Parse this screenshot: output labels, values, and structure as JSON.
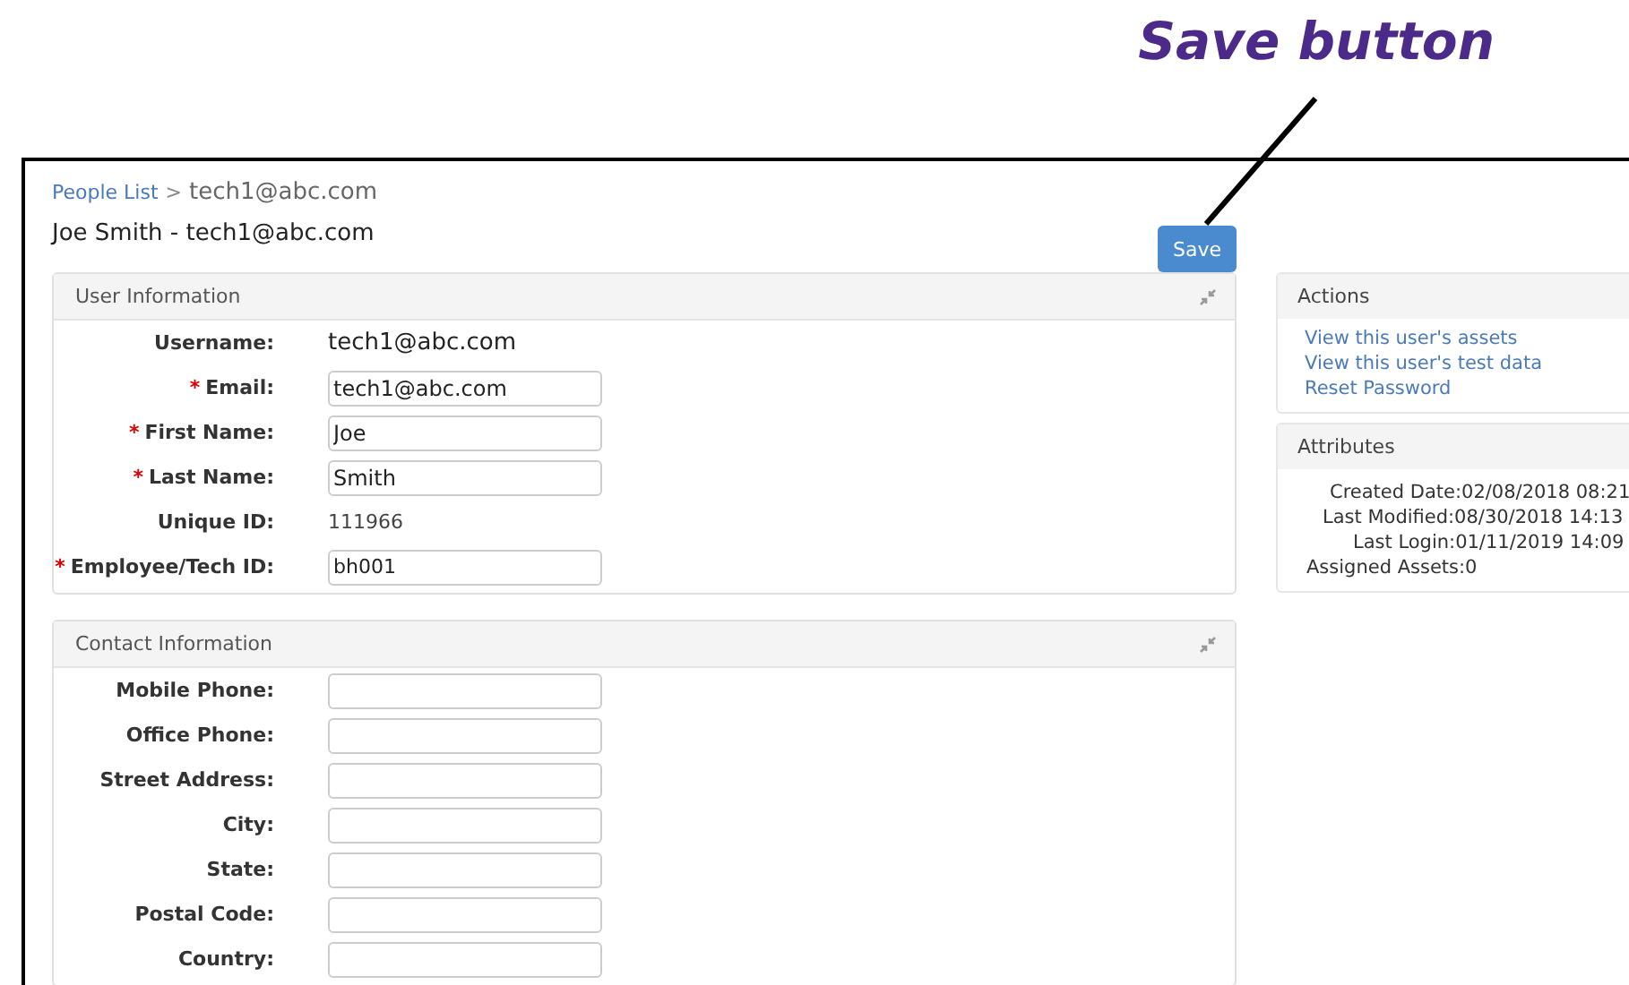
{
  "annotation": {
    "label": "Save button"
  },
  "breadcrumb": {
    "link": "People List",
    "separator": ">",
    "current": "tech1@abc.com"
  },
  "page_title": "Joe Smith - tech1@abc.com",
  "save_button": "Save",
  "user_information": {
    "title": "User Information",
    "fields": [
      {
        "label": "Username:",
        "kind": "text",
        "value": "tech1@abc.com"
      },
      {
        "required_mark": "*",
        "label": "Email:",
        "kind": "input",
        "value": "tech1@abc.com"
      },
      {
        "required_mark": "*",
        "label": "First Name:",
        "kind": "input",
        "value": "Joe"
      },
      {
        "required_mark": "*",
        "label": "Last Name:",
        "kind": "input",
        "value": "Smith"
      },
      {
        "label": "Unique ID:",
        "kind": "small-text",
        "value": "111966"
      },
      {
        "required_mark": "*",
        "label": "Employee/Tech ID:",
        "kind": "small-input",
        "value": "bh001"
      }
    ]
  },
  "contact_information": {
    "title": "Contact Information",
    "fields": [
      {
        "label": "Mobile Phone:",
        "kind": "input"
      },
      {
        "label": "Office Phone:",
        "kind": "input"
      },
      {
        "label": "Street Address:",
        "kind": "input"
      },
      {
        "label": "City:",
        "kind": "input"
      },
      {
        "label": "State:",
        "kind": "input"
      },
      {
        "label": "Postal Code:",
        "kind": "input"
      },
      {
        "label": "Country:",
        "kind": "input"
      }
    ]
  },
  "actions": {
    "title": "Actions",
    "links": [
      "View this user's assets",
      "View this user's test data",
      "Reset Password"
    ]
  },
  "attributes": {
    "title": "Attributes",
    "items": [
      "Created Date:02/08/2018 08:21",
      "Last Modified:08/30/2018 14:13",
      "Last Login:01/11/2019 14:09",
      "Assigned Assets:0"
    ]
  }
}
